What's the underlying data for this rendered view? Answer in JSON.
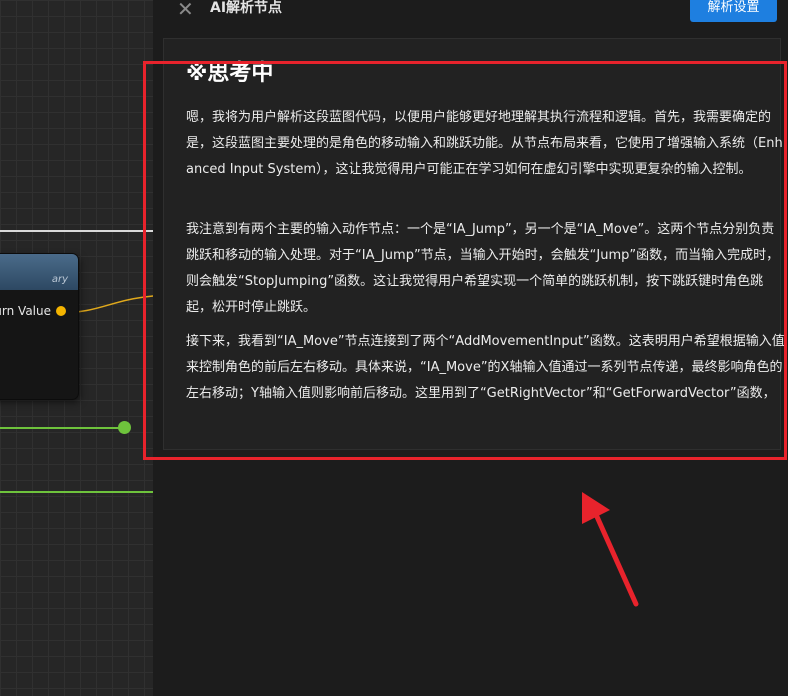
{
  "header": {
    "close_symbol": "✕",
    "title": "AI解析节点",
    "settings_label": "解析设置"
  },
  "blueprint_node": {
    "subtitle": "ary",
    "pin_label": "urn Value"
  },
  "thinking": {
    "title": "※思考中",
    "paragraphs": [
      "嗯，我将为用户解析这段蓝图代码，以便用户能够更好地理解其执行流程和逻辑。首先，我需要确定的是，这段蓝图主要处理的是角色的移动输入和跳跃功能。从节点布局来看，它使用了增强输入系统（Enhanced Input System），这让我觉得用户可能正在学习如何在虚幻引擎中实现更复杂的输入控制。",
      "我注意到有两个主要的输入动作节点：一个是“IA_Jump”，另一个是“IA_Move”。这两个节点分别负责跳跃和移动的输入处理。对于“IA_Jump”节点，当输入开始时，会触发“Jump”函数，而当输入完成时，则会触发“StopJumping”函数。这让我觉得用户希望实现一个简单的跳跃机制，按下跳跃键时角色跳起，松开时停止跳跃。",
      "接下来，我看到“IA_Move”节点连接到了两个“AddMovementInput”函数。这表明用户希望根据输入值来控制角色的前后左右移动。具体来说，“IA_Move”的X轴输入值通过一系列节点传递，最终影响角色的左右移动；Y轴输入值则影响前后移动。这里用到了“GetRightVector”和“GetForwardVector”函数，"
    ]
  },
  "colors": {
    "accent": "#1e7fe0",
    "highlight": "#e8232c",
    "exec_pin": "#f4b400",
    "bool_wire": "#6ec33c"
  }
}
